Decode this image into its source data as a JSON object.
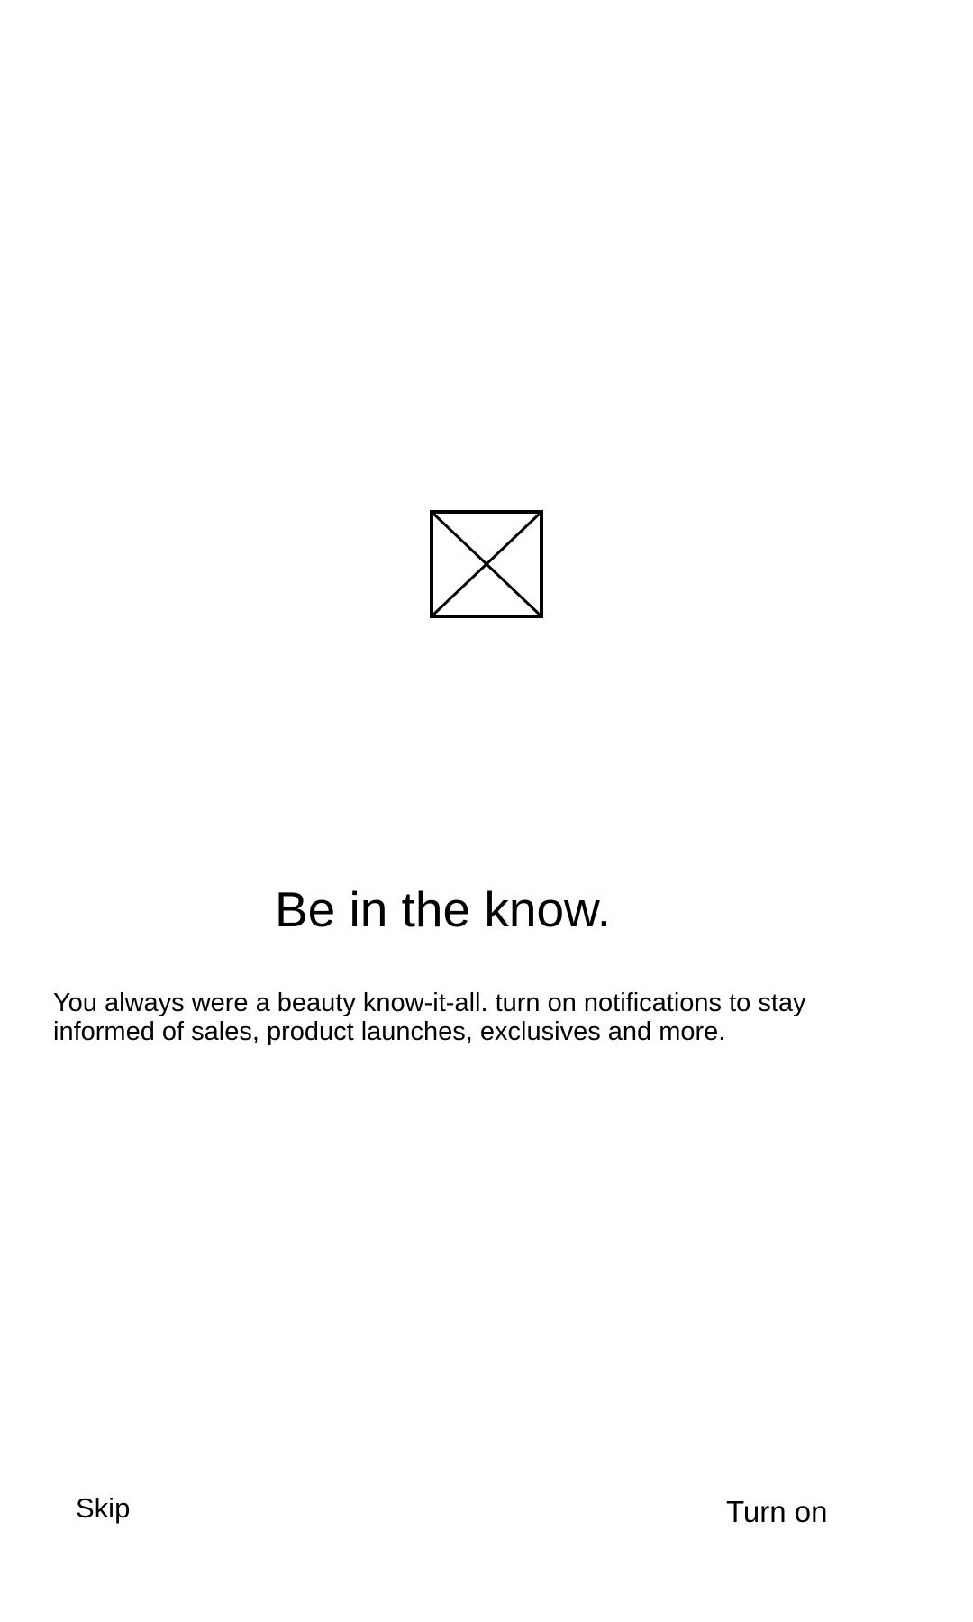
{
  "notification_prompt": {
    "image_icon": "image-placeholder-icon",
    "title": "Be in the know.",
    "description": "You always were a beauty know-it-all. turn on notifications to stay\ninformed of sales, product launches, exclusives and more.",
    "skip_label": "Skip",
    "turn_on_label": "Turn on"
  },
  "colors": {
    "background": "#ffffff",
    "text": "#000000",
    "icon_stroke": "#000000"
  }
}
